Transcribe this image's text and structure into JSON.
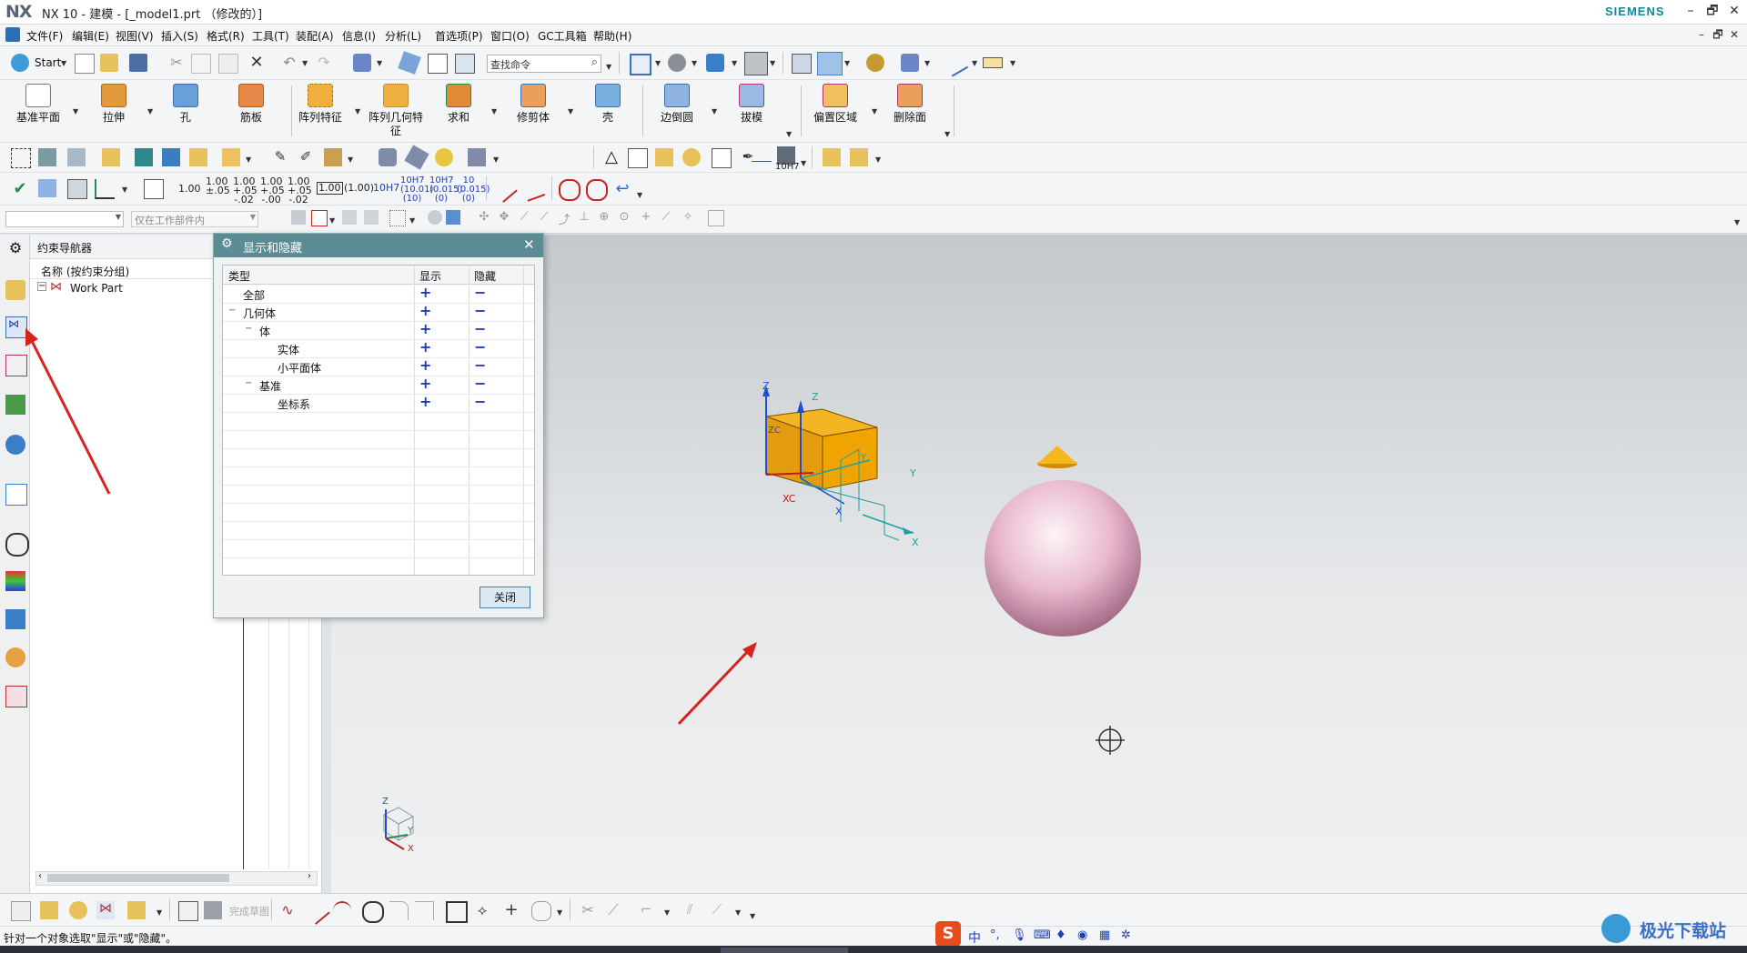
{
  "window": {
    "logo": "NX",
    "title": "NX 10 - 建模 - [_model1.prt （修改的）]",
    "brand": "SIEMENS",
    "buttons": [
      "–",
      "🗗",
      "✕"
    ]
  },
  "menubar": {
    "items": [
      "文件(F)",
      "编辑(E)",
      "视图(V)",
      "插入(S)",
      "格式(R)",
      "工具(T)",
      "装配(A)",
      "信息(I)",
      "分析(L)",
      "首选项(P)",
      "窗口(O)",
      "GC工具箱",
      "帮助(H)"
    ]
  },
  "quickaccess": {
    "start_label": "Start",
    "search_placeholder": "查找命令"
  },
  "ribbon": {
    "buttons": [
      "基准平面",
      "拉伸",
      "孔",
      "筋板",
      "阵列特征",
      "阵列几何特征",
      "求和",
      "修剪体",
      "壳",
      "边倒圆",
      "拔模",
      "偏置区域",
      "删除面"
    ]
  },
  "dimension_labels": [
    "1.00",
    "1.00 ±.05",
    "1.00 +.05 -.02",
    "1.00 +.05 -.00",
    "1.00 +.05 -.02",
    "1.00",
    "(1.00)",
    "10H7",
    "10H7 (10.01) (10)",
    "10H7 (0.015) (0)",
    "10 (0.015) (0)"
  ],
  "tolerance_dropdown_label": "10H7",
  "selection_bar": {
    "filter_placeholder": "",
    "scope_value": "仅在工作部件内"
  },
  "navigator": {
    "title": "约束导航器",
    "column_header": "名称 (按约束分组)",
    "root_item": "Work Part"
  },
  "dialog": {
    "title": "显示和隐藏",
    "columns": [
      "类型",
      "显示",
      "隐藏"
    ],
    "rows": [
      {
        "label": "全部",
        "level": 0,
        "expander": ""
      },
      {
        "label": "几何体",
        "level": 0,
        "expander": "−"
      },
      {
        "label": "体",
        "level": 1,
        "expander": "−"
      },
      {
        "label": "实体",
        "level": 2,
        "expander": ""
      },
      {
        "label": "小平面体",
        "level": 2,
        "expander": ""
      },
      {
        "label": "基准",
        "level": 1,
        "expander": "−"
      },
      {
        "label": "坐标系",
        "level": 2,
        "expander": ""
      }
    ],
    "show_symbol": "+",
    "hide_symbol": "−",
    "close_label": "关闭"
  },
  "scene": {
    "axis_labels": {
      "z": "Z",
      "zc": "ZC",
      "xc": "XC",
      "y": "Y",
      "x": "X",
      "yc": "YC"
    }
  },
  "bottom_toolbar": {
    "finish_sketch_label": "完成草图"
  },
  "status_bar": {
    "message": "针对一个对象选取\"显示\"或\"隐藏\"。",
    "ime_label": "中"
  },
  "watermark": "极光下载站",
  "colors": {
    "dialog_header": "#5c8c93",
    "accent_blue": "#1c3fb8",
    "cube_orange": "#f0a400",
    "sphere_pink": "#e9b9cf",
    "annotation_arrow": "#d8221c"
  }
}
